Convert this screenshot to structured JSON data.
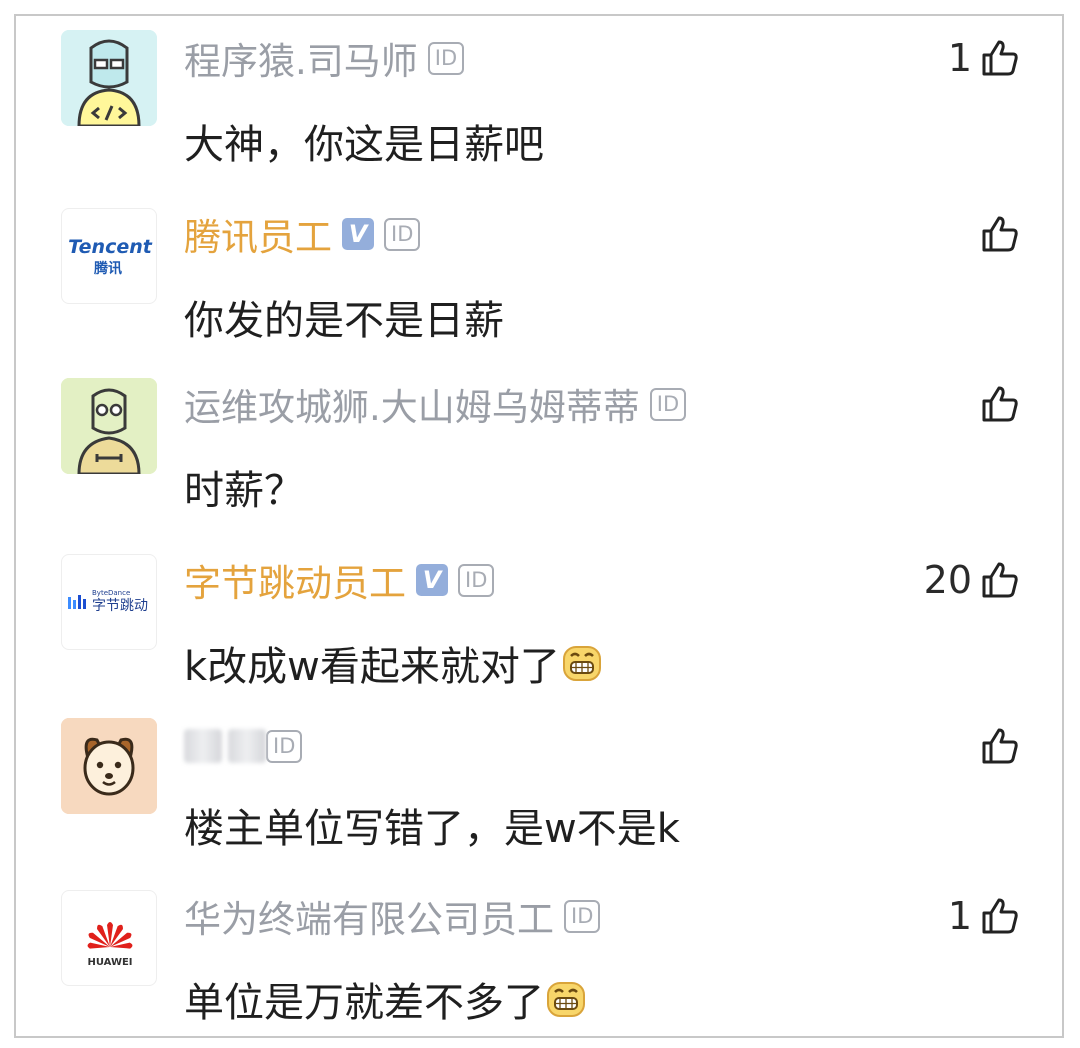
{
  "comments": [
    {
      "name": "程序猿.司马师",
      "verified": false,
      "id_badge": "ID",
      "likes": "1",
      "text": "大神，你这是日薪吧",
      "emoji": false,
      "avatar": "programmer-avatar-icon"
    },
    {
      "name": "腾讯员工",
      "verified": true,
      "verified_badge": "V",
      "id_badge": "ID",
      "likes": "",
      "text": "你发的是不是日薪",
      "emoji": false,
      "avatar": "tencent-logo",
      "avatar_text": [
        "Tencent",
        "腾讯"
      ]
    },
    {
      "name": "运维攻城狮.大山姆乌姆蒂蒂",
      "verified": false,
      "id_badge": "ID",
      "likes": "",
      "text": "时薪？",
      "emoji": false,
      "avatar": "ops-engineer-avatar-icon"
    },
    {
      "name": "字节跳动员工",
      "verified": true,
      "verified_badge": "V",
      "id_badge": "ID",
      "likes": "20",
      "text": "k改成w看起来就对了",
      "emoji": true,
      "emoji_name": "grin-emoji-icon",
      "avatar": "bytedance-logo",
      "avatar_text": [
        "ByteDance",
        "字节跳动"
      ]
    },
    {
      "name": "",
      "name_blurred": true,
      "verified": false,
      "id_badge": "ID",
      "likes": "",
      "text": "楼主单位写错了，是w不是k",
      "emoji": false,
      "avatar": "dog-avatar-icon"
    },
    {
      "name": "华为终端有限公司员工",
      "verified": false,
      "id_badge": "ID",
      "likes": "1",
      "text": "单位是万就差不多了",
      "emoji": true,
      "emoji_name": "grin-emoji-icon",
      "avatar": "huawei-logo",
      "avatar_text": [
        "HUAWEI"
      ]
    }
  ],
  "colors": {
    "staff_name": "#e4a33d",
    "user_name": "#9a9ea6",
    "verified_badge": "#94aedb",
    "content_text": "#1f1f1f"
  }
}
